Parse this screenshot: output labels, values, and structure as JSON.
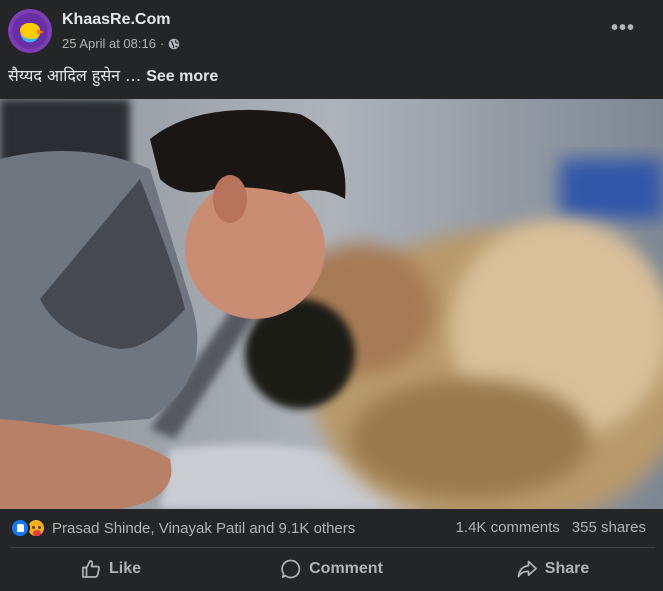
{
  "post": {
    "page_name": "KhaasRe.Com",
    "timestamp": "25 April at 08:16",
    "separator": "·",
    "audience_icon": "globe-icon",
    "more_icon": "more-options-icon",
    "more_label": "•••",
    "text": "सैय्यद आदिल हुसेन … ",
    "see_more": "See more"
  },
  "reactions": {
    "icons": [
      "like-reaction-icon",
      "care-reaction-icon"
    ],
    "reactors_text": "Prasad Shinde, Vinayak Patil and 9.1K others",
    "comments": "1.4K comments",
    "shares": "355 shares"
  },
  "actions": {
    "like": "Like",
    "comment": "Comment",
    "share": "Share"
  },
  "colors": {
    "background": "#242526",
    "text_primary": "#e4e6eb",
    "text_secondary": "#b0b3b8",
    "like_blue": "#1877f2",
    "care_yellow": "#f7b125"
  }
}
